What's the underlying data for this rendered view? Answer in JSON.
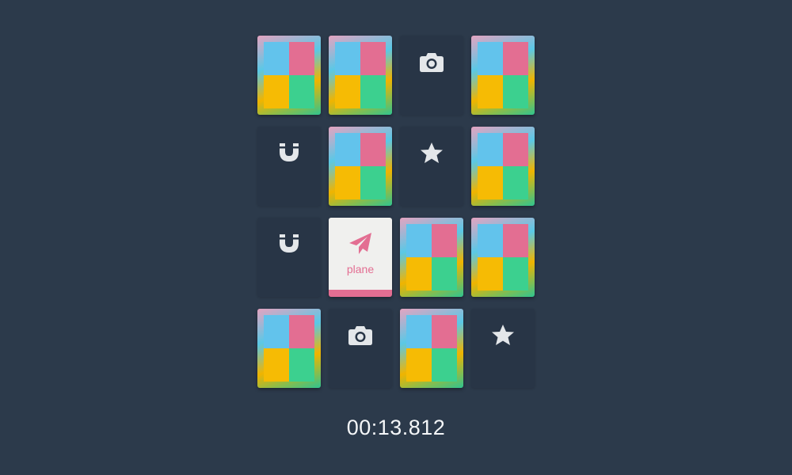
{
  "game": {
    "type": "memory-match",
    "grid": {
      "rows": 4,
      "columns": 4
    },
    "card_back_colors": [
      "#62c3ec",
      "#e36e92",
      "#f6bb04",
      "#3cd08f"
    ],
    "cards": [
      {
        "state": "face-down"
      },
      {
        "state": "face-down"
      },
      {
        "state": "matched",
        "icon": "camera-icon"
      },
      {
        "state": "face-down"
      },
      {
        "state": "matched",
        "icon": "magnet-icon"
      },
      {
        "state": "face-down"
      },
      {
        "state": "matched",
        "icon": "star-icon"
      },
      {
        "state": "face-down"
      },
      {
        "state": "matched",
        "icon": "magnet-icon"
      },
      {
        "state": "flipped",
        "icon": "plane-icon",
        "label": "plane"
      },
      {
        "state": "face-down"
      },
      {
        "state": "face-down"
      },
      {
        "state": "face-down"
      },
      {
        "state": "matched",
        "icon": "camera-icon"
      },
      {
        "state": "face-down"
      },
      {
        "state": "matched",
        "icon": "star-icon"
      }
    ],
    "flipped_accent": "#e36e92",
    "matched_icon_color": "#e4e7ea"
  },
  "timer": {
    "value": "00:13.812"
  }
}
